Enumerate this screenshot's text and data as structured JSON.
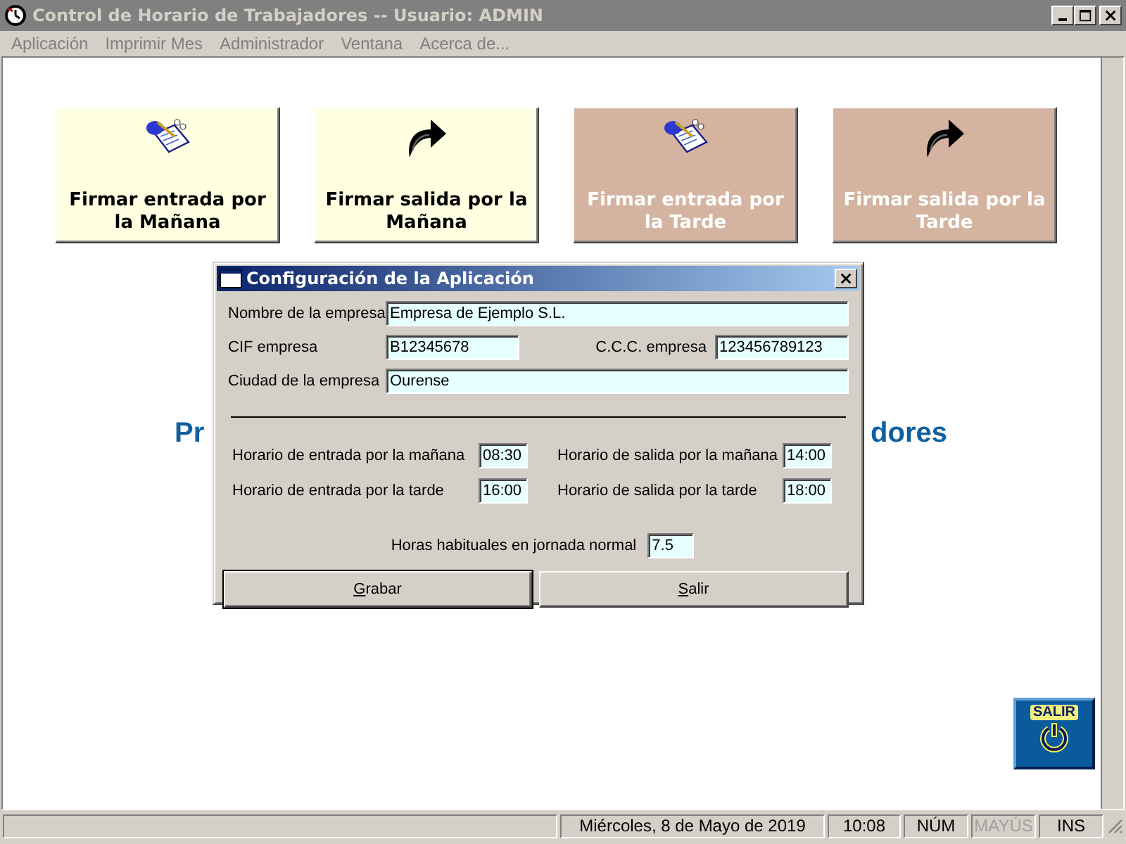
{
  "window": {
    "title": "Control de Horario de Trabajadores --  Usuario: ADMIN"
  },
  "menu": [
    "Aplicación",
    "Imprimir Mes",
    "Administrador",
    "Ventana",
    "Acerca de..."
  ],
  "sign_buttons": [
    {
      "label": "Firmar entrada por la Mañana",
      "kind": "sign-in",
      "enabled": true
    },
    {
      "label": "Firmar salida por la Mañana",
      "kind": "sign-out",
      "enabled": true
    },
    {
      "label": "Firmar entrada por la Tarde",
      "kind": "sign-in",
      "enabled": false
    },
    {
      "label": "Firmar salida por la Tarde",
      "kind": "sign-out",
      "enabled": false
    }
  ],
  "heading": {
    "left_part": "Pr",
    "right_part": "dores"
  },
  "dialog": {
    "title": "Configuración de la Aplicación",
    "company_name": {
      "label": "Nombre de la empresa",
      "value": "Empresa de Ejemplo S.L."
    },
    "cif": {
      "label": "CIF empresa",
      "value": "B12345678"
    },
    "ccc": {
      "label": "C.C.C. empresa",
      "value": "123456789123"
    },
    "city": {
      "label": "Ciudad de la empresa",
      "value": "Ourense"
    },
    "schedule": [
      {
        "label": "Horario de entrada por la mañana",
        "value": "08:30"
      },
      {
        "label": "Horario de salida por la mañana",
        "value": "14:00"
      },
      {
        "label": "Horario de entrada por la tarde",
        "value": "16:00"
      },
      {
        "label": "Horario de salida por la tarde",
        "value": "18:00"
      }
    ],
    "hours": {
      "label": "Horas habituales en jornada normal",
      "value": "7.5"
    },
    "buttons": [
      "Grabar",
      "Salir"
    ]
  },
  "exit_button": {
    "label": "SALIR"
  },
  "status_bar": {
    "date": "Miércoles, 8 de Mayo de 2019",
    "time": "10:08",
    "indicators": [
      {
        "label": "NÚM",
        "enabled": true
      },
      {
        "label": "MAYÚS",
        "enabled": false
      },
      {
        "label": "INS",
        "enabled": true
      }
    ]
  }
}
